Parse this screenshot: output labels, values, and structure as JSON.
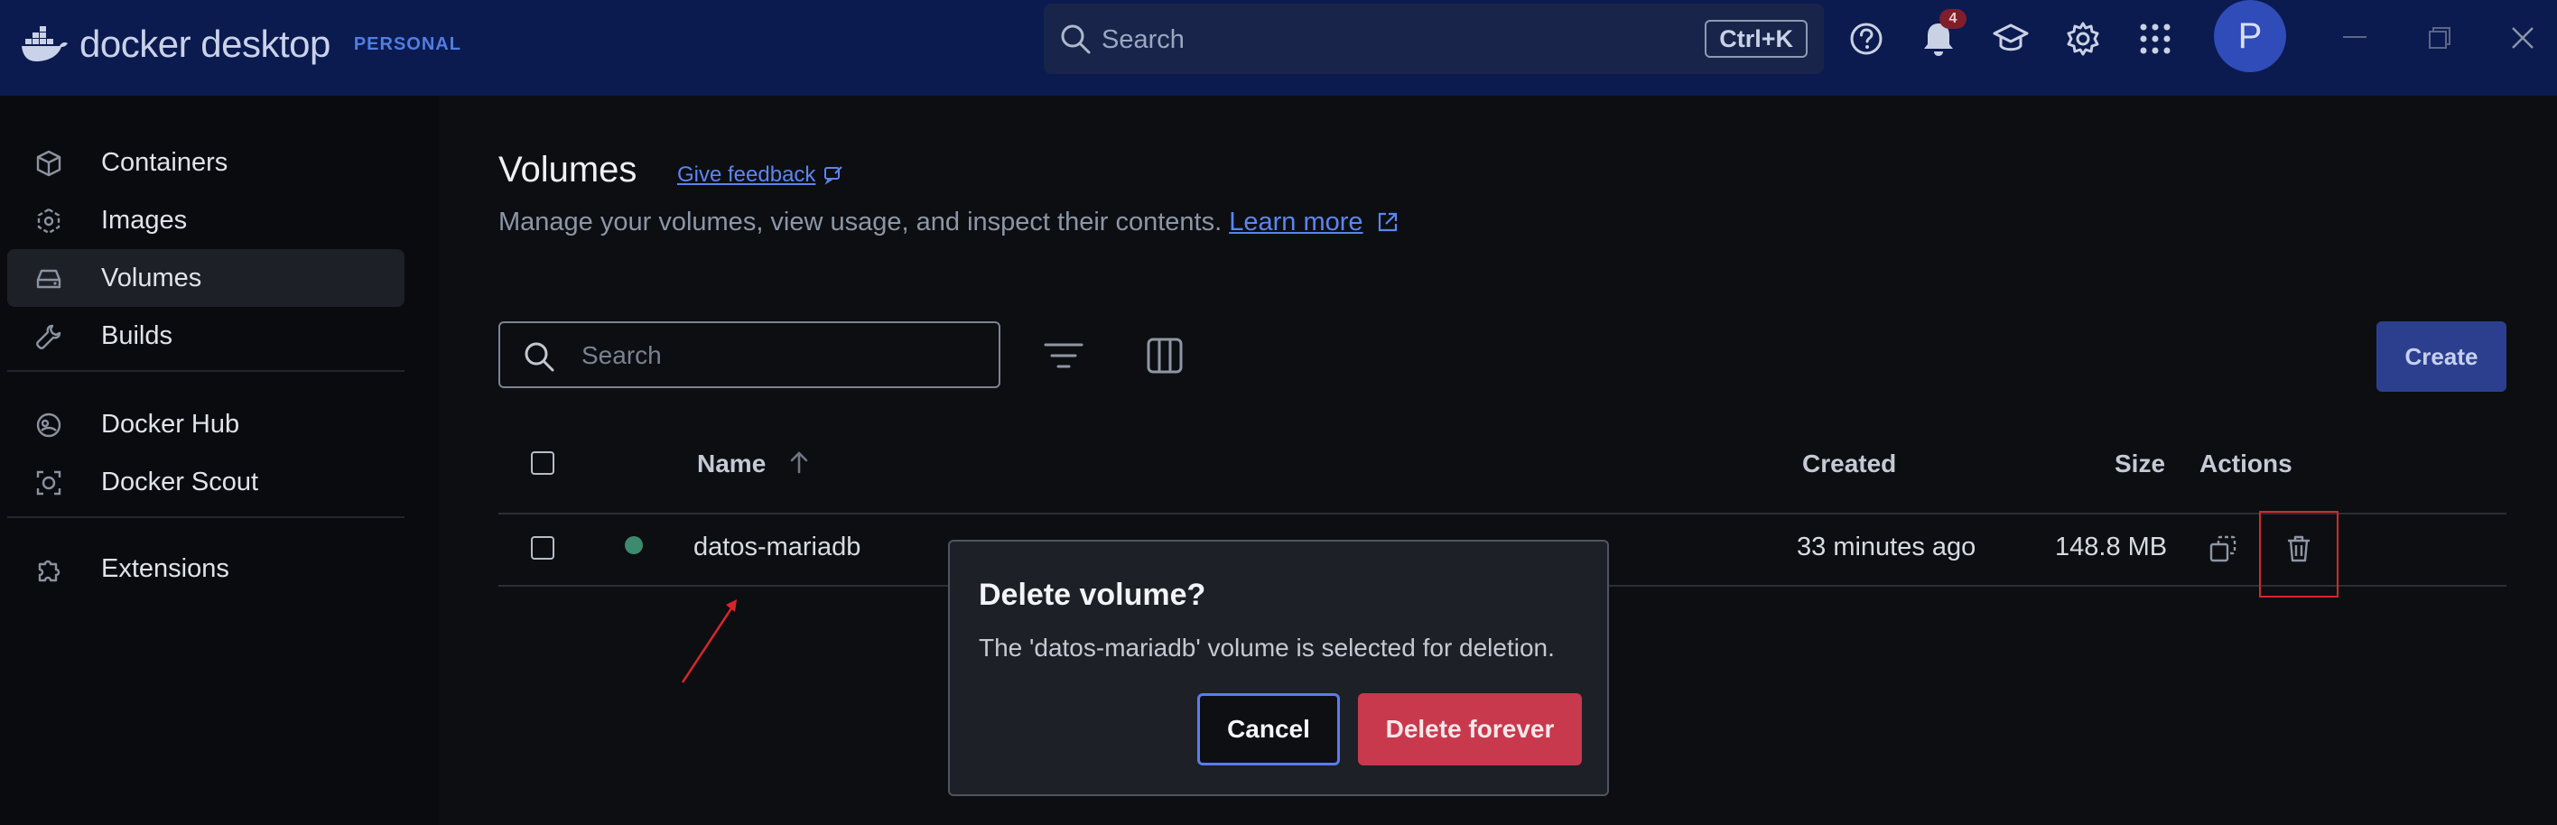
{
  "app": {
    "brand_name": "docker desktop",
    "plan": "PERSONAL"
  },
  "global_search": {
    "placeholder": "Search",
    "shortcut": "Ctrl+K"
  },
  "notifications": {
    "count": "4"
  },
  "user": {
    "avatar_initial": "P"
  },
  "sidebar": {
    "items": [
      {
        "label": "Containers",
        "icon": "containers-icon"
      },
      {
        "label": "Images",
        "icon": "images-icon"
      },
      {
        "label": "Volumes",
        "icon": "volumes-icon",
        "active": true
      },
      {
        "label": "Builds",
        "icon": "builds-icon"
      },
      {
        "label": "Docker Hub",
        "icon": "docker-hub-icon"
      },
      {
        "label": "Docker Scout",
        "icon": "docker-scout-icon"
      },
      {
        "label": "Extensions",
        "icon": "extensions-icon"
      }
    ]
  },
  "page": {
    "title": "Volumes",
    "feedback_link": "Give feedback",
    "subtitle": "Manage your volumes, view usage, and inspect their contents.",
    "learn_more": "Learn more"
  },
  "toolbar": {
    "search_placeholder": "Search",
    "create_label": "Create"
  },
  "table": {
    "columns": {
      "name": "Name",
      "created": "Created",
      "size": "Size",
      "actions": "Actions"
    },
    "sort": {
      "column": "Name",
      "direction": "ascending"
    },
    "rows": [
      {
        "name": "datos-mariadb",
        "status": "in use",
        "created": "33 minutes ago",
        "size": "148.8 MB"
      }
    ]
  },
  "dialog": {
    "title": "Delete volume?",
    "body": "The 'datos-mariadb' volume is selected for deletion.",
    "cancel_label": "Cancel",
    "confirm_label": "Delete forever"
  },
  "colors": {
    "titlebar": "#0b1a4f",
    "accent": "#5b86f0",
    "danger": "#c8394d",
    "status_green": "#3d8a6e",
    "annotation_red": "#d6262a"
  }
}
